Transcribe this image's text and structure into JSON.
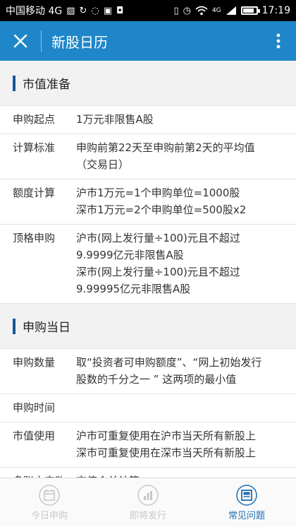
{
  "status_bar": {
    "carrier": "中国移动 4G",
    "network": "4G",
    "time": "17:19",
    "battery_fraction": 0.85
  },
  "toolbar": {
    "title": "新股日历",
    "close_icon": "close-icon",
    "menu_icon": "more-vert-icon"
  },
  "sections": [
    {
      "title": "市值准备",
      "rows": [
        {
          "label": "申购起点",
          "lines": [
            "1万元非限售A股"
          ]
        },
        {
          "label": "计算标准",
          "lines": [
            "申购前第22天至申购前第2天的平均值",
            "（交易日）"
          ]
        },
        {
          "label": "额度计算",
          "lines": [
            "沪市1万元=1个申购单位=1000股",
            "深市1万元=2个申购单位=500股x2"
          ]
        },
        {
          "label": "顶格申购",
          "lines": [
            "沪市(网上发行量÷100)元且不超过",
            "9.9999亿元非限售A股",
            "深市(网上发行量÷100)元且不超过",
            "9.99995亿元非限售A股"
          ]
        }
      ]
    },
    {
      "title": "申购当日",
      "rows": [
        {
          "label": "申购数量",
          "lines": [
            "取“投资者可申购额度”、“网上初始发行",
            "股数的千分之一 ” 这两项的最小值"
          ]
        },
        {
          "label": "申购时间",
          "lines": [
            ""
          ]
        },
        {
          "label": "市值使用",
          "lines": [
            "沪市可重复使用在沪市当天所有新股上",
            "深市可重复使用在深市当天所有新股上"
          ]
        },
        {
          "label": "多账户申购",
          "lines": [
            "市值合并计算"
          ]
        }
      ]
    }
  ],
  "tabs": [
    {
      "label": "今日申购",
      "icon": "calendar-icon",
      "active": false
    },
    {
      "label": "即将发行",
      "icon": "chart-icon",
      "active": false
    },
    {
      "label": "常见问题",
      "icon": "faq-icon",
      "active": true
    }
  ],
  "colors": {
    "toolbar": "#1f87c9",
    "section_bar": "#17579d",
    "tab_active": "#1f6fb4",
    "tab_inactive": "#c8c8c8"
  }
}
